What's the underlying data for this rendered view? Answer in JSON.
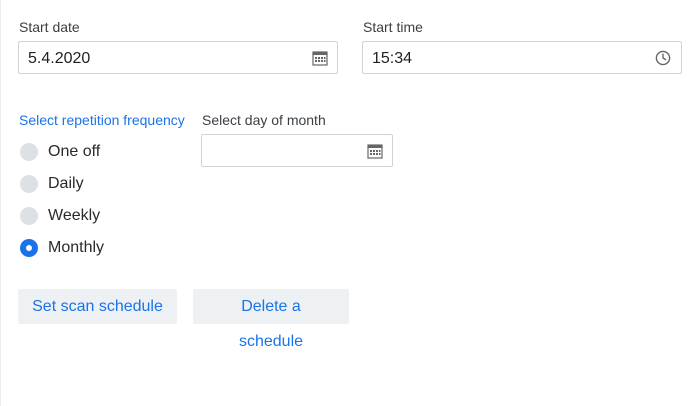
{
  "start_date": {
    "label": "Start date",
    "value": "5.4.2020",
    "icon": "calendar-icon"
  },
  "start_time": {
    "label": "Start time",
    "value": "15:34",
    "icon": "clock-icon"
  },
  "frequency": {
    "label": "Select repetition frequency",
    "options": [
      {
        "label": "One off",
        "checked": false
      },
      {
        "label": "Daily",
        "checked": false
      },
      {
        "label": "Weekly",
        "checked": false
      },
      {
        "label": "Monthly",
        "checked": true
      }
    ]
  },
  "day_of_month": {
    "label": "Select day of month",
    "value": "",
    "icon": "calendar-icon"
  },
  "buttons": {
    "set": "Set scan schedule",
    "delete": "Delete a schedule"
  },
  "colors": {
    "accent": "#1a73e8",
    "button_bg": "#eef1f4",
    "radio_off": "#dde0e4"
  }
}
